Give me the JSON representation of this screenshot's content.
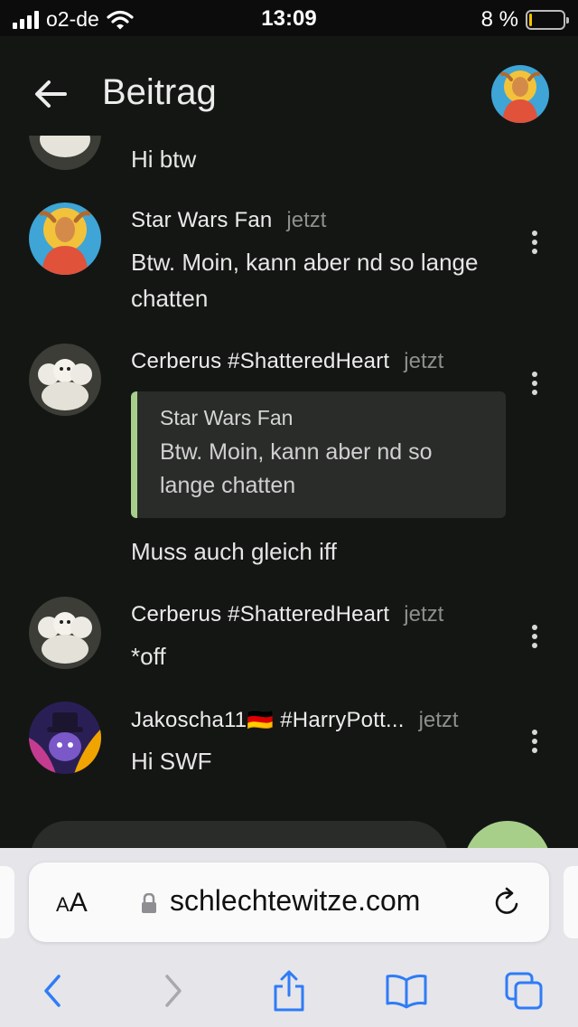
{
  "status_bar": {
    "carrier": "o2-de",
    "time": "13:09",
    "battery_percent": "8 %",
    "battery_level": 0.08
  },
  "header": {
    "title": "Beitrag"
  },
  "colors": {
    "accent": "#a8cf8a",
    "background": "#141614",
    "quote_bg": "#2a2c2a"
  },
  "feed": {
    "partial_message": {
      "text": "Hi btw"
    },
    "messages": [
      {
        "author": "Star Wars Fan",
        "time": "jetzt",
        "text": "Btw. Moin, kann aber nd so lange chatten"
      },
      {
        "author": "Cerberus #ShatteredHeart",
        "time": "jetzt",
        "quote": {
          "author": "Star Wars Fan",
          "text": "Btw. Moin, kann aber nd so lange chatten"
        },
        "text": "Muss auch gleich iff"
      },
      {
        "author": "Cerberus #ShatteredHeart",
        "time": "jetzt",
        "text": "*off"
      },
      {
        "author": "Jakoscha11🇩🇪 #HarryPott...",
        "time": "jetzt",
        "text": "Hi SWF"
      }
    ]
  },
  "browser": {
    "text_size_label_small": "A",
    "text_size_label_large": "A",
    "url": "schlechtewitze.com"
  }
}
